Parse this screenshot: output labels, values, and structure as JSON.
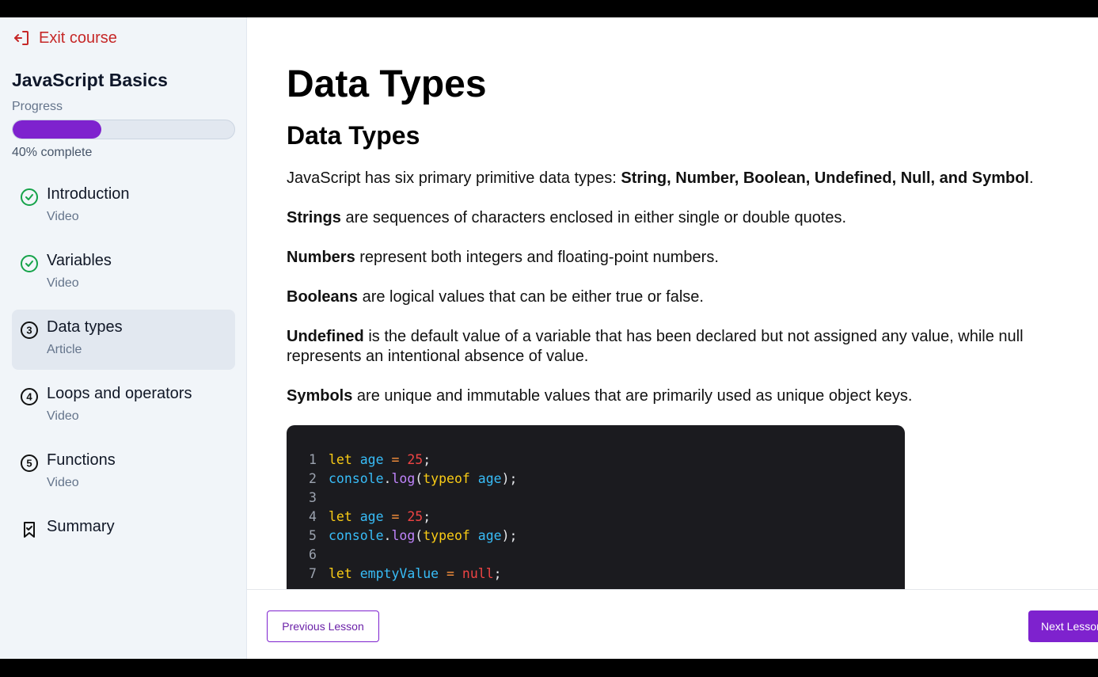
{
  "sidebar": {
    "exit_label": "Exit course",
    "course_title": "JavaScript Basics",
    "progress_label": "Progress",
    "progress_percent": 40,
    "progress_text": "40% complete",
    "lessons": [
      {
        "label": "Introduction",
        "type": "Video",
        "status": "completed",
        "icon": "check-circle-icon"
      },
      {
        "label": "Variables",
        "type": "Video",
        "status": "completed",
        "icon": "check-circle-icon"
      },
      {
        "label": "Data types",
        "type": "Article",
        "status": "current",
        "number": "3",
        "icon": "number-3-circle-icon"
      },
      {
        "label": "Loops and operators",
        "type": "Video",
        "status": "pending",
        "number": "4",
        "icon": "number-4-circle-icon"
      },
      {
        "label": "Functions",
        "type": "Video",
        "status": "pending",
        "number": "5",
        "icon": "number-5-circle-icon"
      },
      {
        "label": "Summary",
        "type": "",
        "status": "pending",
        "icon": "bookmark-icon"
      }
    ]
  },
  "main": {
    "title": "Data Types",
    "subtitle": "Data Types",
    "intro": {
      "text": "JavaScript has six primary primitive data types: ",
      "bold": "String, Number, Boolean, Undefined, Null, and Symbol",
      "end": "."
    },
    "paragraphs": [
      {
        "bold": "Strings",
        "text": " are sequences of characters enclosed in either single or double quotes."
      },
      {
        "bold": "Numbers",
        "text": " represent both integers and floating-point numbers."
      },
      {
        "bold": "Booleans",
        "text": " are logical values that can be either true or false."
      },
      {
        "bold": "Undefined",
        "text": " is the default value of a variable that has been declared but not assigned any value, while null represents an intentional absence of value."
      },
      {
        "bold": "Symbols",
        "text": " are unique and immutable values that are primarily used as unique object keys."
      }
    ],
    "code_lines": [
      "let age = 25;",
      "console.log(typeof age);",
      "",
      "let age = 25;",
      "console.log(typeof age);",
      "",
      "let emptyValue = null;"
    ]
  },
  "footer": {
    "prev_label": "Previous Lesson",
    "next_label": "Next Lesson"
  },
  "colors": {
    "accent": "#7e22ce",
    "exit": "#c62828",
    "completed": "#16a34a"
  }
}
